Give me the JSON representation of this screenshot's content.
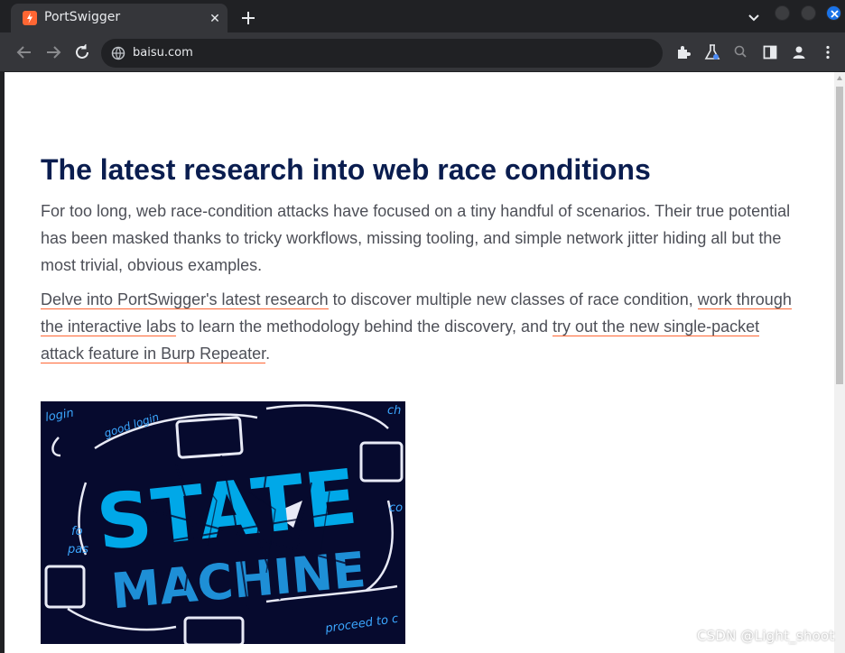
{
  "browser": {
    "tab_title": "PortSwigger",
    "tab_close": "✕",
    "url": "baisu.com"
  },
  "article": {
    "headline": "The latest research into web race conditions",
    "intro": "For too long, web race-condition attacks have focused on a tiny handful of scenarios. Their true potential has been masked thanks to tricky workflows, missing tooling, and simple network jitter hiding all but the most trivial, obvious examples.",
    "link1": "Delve into PortSwigger's latest research",
    "text1": " to discover multiple new classes of race condition, ",
    "link2": "work through the interactive labs",
    "text2": " to learn the methodology behind the discovery, and ",
    "link3": "try out the new single-packet attack feature in Burp Repeater",
    "text3": "."
  },
  "hero_image": {
    "title_line1": "STATE",
    "title_line2": "MACHINE",
    "scribbles": [
      "login",
      "good login",
      "ch",
      "fo",
      "pas",
      "co",
      "proceed to c"
    ]
  },
  "watermark": "CSDN @Light_shoot",
  "colors": {
    "accent": "#ff6633",
    "headline": "#0a1d4f",
    "hero_bg": "#060a2e",
    "hero_text": "#00a8e8"
  }
}
